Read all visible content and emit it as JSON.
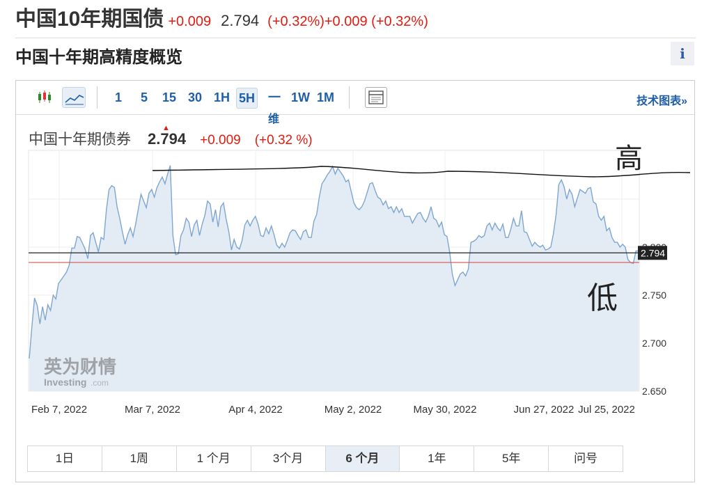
{
  "header": {
    "name": "中国10年期国债",
    "change": "+0.009",
    "price": "2.794",
    "pct": "(+0.32%)+0.009 (+0.32%)"
  },
  "subheader": {
    "title": "中国十年期高精度概览",
    "info_label": "i"
  },
  "toolbar": {
    "intervals": [
      "1",
      "5",
      "15",
      "30",
      "1H",
      "5H",
      "一",
      "1W",
      "1M"
    ],
    "selected_interval": "5H",
    "interval_sub": "维",
    "tech_chart_label": "技术图表»",
    "icons": [
      "candlestick-icon",
      "line-chart-icon",
      "panel-toggle-icon"
    ]
  },
  "legend": {
    "name": "中国十年期债券",
    "value": "2.794",
    "change": "+0.009",
    "pct": "(+0.32 %)"
  },
  "watermark": {
    "cn": "英为财情",
    "en": "Investing",
    "suffix": ".com"
  },
  "annotations": {
    "high": "高",
    "low": "低"
  },
  "ranges": [
    "1日",
    "1周",
    "1 个月",
    "3个月",
    "6 个月",
    "1年",
    "5年",
    "问号"
  ],
  "selected_range": "6 个月",
  "colors": {
    "line": "#7ea6cf",
    "area": "#e3ecf5",
    "up": "#e31b0f",
    "ref_line": "#d9534f",
    "link": "#1f5fa8"
  },
  "chart_data": {
    "type": "area",
    "x_tick_labels": [
      "Feb 7, 2022",
      "Mar 7, 2022",
      "Apr 4, 2022",
      "May 2, 2022",
      "May 30, 2022",
      "Jun 27, 2022",
      "Jul 25, 2022"
    ],
    "y_tick_labels": [
      "2.800",
      "2.750",
      "2.700",
      "2.650"
    ],
    "ylim": [
      2.65,
      2.8
    ],
    "current_value_label": "2.794",
    "current_value": 2.794,
    "reference_value": 2.784,
    "grid": true,
    "series": [
      {
        "values": [
          2.684,
          2.717,
          2.747,
          2.739,
          2.72,
          2.738,
          2.724,
          2.74,
          2.734,
          2.75,
          2.746,
          2.762,
          2.766,
          2.77,
          2.774,
          2.781,
          2.799,
          2.799,
          2.811,
          2.81,
          2.804,
          2.798,
          2.788,
          2.812,
          2.815,
          2.805,
          2.795,
          2.81,
          2.808,
          2.839,
          2.86,
          2.864,
          2.862,
          2.842,
          2.83,
          2.816,
          2.803,
          2.813,
          2.82,
          2.811,
          2.824,
          2.84,
          2.855,
          2.848,
          2.841,
          2.856,
          2.86,
          2.852,
          2.862,
          2.868,
          2.873,
          2.866,
          2.876,
          2.885,
          2.812,
          2.792,
          2.793,
          2.812,
          2.818,
          2.83,
          2.826,
          2.811,
          2.823,
          2.828,
          2.812,
          2.824,
          2.833,
          2.848,
          2.845,
          2.826,
          2.839,
          2.821,
          2.842,
          2.846,
          2.829,
          2.816,
          2.797,
          2.808,
          2.8,
          2.798,
          2.807,
          2.823,
          2.828,
          2.822,
          2.828,
          2.832,
          2.824,
          2.812,
          2.811,
          2.82,
          2.814,
          2.822,
          2.813,
          2.802,
          2.799,
          2.804,
          2.8,
          2.807,
          2.815,
          2.818,
          2.817,
          2.812,
          2.808,
          2.816,
          2.818,
          2.81,
          2.81,
          2.827,
          2.834,
          2.852,
          2.866,
          2.87,
          2.875,
          2.879,
          2.884,
          2.876,
          2.882,
          2.878,
          2.874,
          2.868,
          2.87,
          2.858,
          2.846,
          2.841,
          2.839,
          2.842,
          2.848,
          2.857,
          2.866,
          2.867,
          2.859,
          2.852,
          2.85,
          2.844,
          2.848,
          2.84,
          2.842,
          2.836,
          2.842,
          2.836,
          2.84,
          2.832,
          2.832,
          2.832,
          2.825,
          2.83,
          2.835,
          2.836,
          2.83,
          2.826,
          2.832,
          2.842,
          2.83,
          2.828,
          2.821,
          2.826,
          2.813,
          2.811,
          2.795,
          2.772,
          2.76,
          2.766,
          2.772,
          2.774,
          2.77,
          2.777,
          2.805,
          2.806,
          2.808,
          2.812,
          2.81,
          2.812,
          2.822,
          2.825,
          2.818,
          2.825,
          2.82,
          2.817,
          2.824,
          2.81,
          2.81,
          2.819,
          2.83,
          2.822,
          2.822,
          2.838,
          2.816,
          2.815,
          2.808,
          2.801,
          2.805,
          2.802,
          2.8,
          2.802,
          2.797,
          2.798,
          2.8,
          2.814,
          2.834,
          2.865,
          2.87,
          2.863,
          2.85,
          2.86,
          2.855,
          2.842,
          2.851,
          2.86,
          2.858,
          2.856,
          2.861,
          2.862,
          2.847,
          2.845,
          2.832,
          2.828,
          2.832,
          2.817,
          2.82,
          2.81,
          2.805,
          2.805,
          2.8,
          2.803,
          2.8,
          2.787,
          2.784,
          2.783,
          2.796,
          2.796
        ]
      }
    ]
  }
}
